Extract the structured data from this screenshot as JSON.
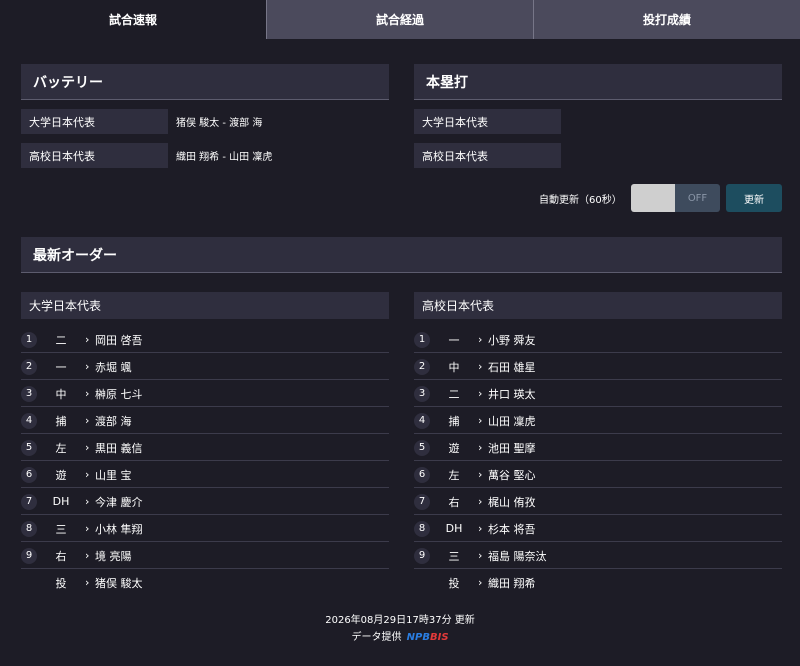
{
  "tabs": [
    "試合速報",
    "試合経過",
    "投打成績"
  ],
  "battery": {
    "title": "バッテリー",
    "rows": [
      {
        "team": "大学日本代表",
        "value": "猪俣 駿太 - 渡部 海"
      },
      {
        "team": "高校日本代表",
        "value": "織田 翔希 - 山田 凜虎"
      }
    ]
  },
  "homerun": {
    "title": "本塁打",
    "rows": [
      {
        "team": "大学日本代表",
        "value": ""
      },
      {
        "team": "高校日本代表",
        "value": ""
      }
    ]
  },
  "auto_refresh": {
    "label": "自動更新（60秒）",
    "state": "OFF",
    "button": "更新"
  },
  "order": {
    "title": "最新オーダー",
    "teams": [
      {
        "name": "大学日本代表",
        "players": [
          {
            "num": "1",
            "pos": "二",
            "name": "岡田 啓吾"
          },
          {
            "num": "2",
            "pos": "一",
            "name": "赤堀 颯"
          },
          {
            "num": "3",
            "pos": "中",
            "name": "榊原 七斗"
          },
          {
            "num": "4",
            "pos": "捕",
            "name": "渡部 海"
          },
          {
            "num": "5",
            "pos": "左",
            "name": "黒田 義信"
          },
          {
            "num": "6",
            "pos": "遊",
            "name": "山里 宝"
          },
          {
            "num": "7",
            "pos": "DH",
            "name": "今津 慶介"
          },
          {
            "num": "8",
            "pos": "三",
            "name": "小林 隼翔"
          },
          {
            "num": "9",
            "pos": "右",
            "name": "境 亮陽"
          },
          {
            "num": "",
            "pos": "投",
            "name": "猪俣 駿太"
          }
        ]
      },
      {
        "name": "高校日本代表",
        "players": [
          {
            "num": "1",
            "pos": "一",
            "name": "小野 舜友"
          },
          {
            "num": "2",
            "pos": "中",
            "name": "石田 雄星"
          },
          {
            "num": "3",
            "pos": "二",
            "name": "井口 瑛太"
          },
          {
            "num": "4",
            "pos": "捕",
            "name": "山田 凜虎"
          },
          {
            "num": "5",
            "pos": "遊",
            "name": "池田 聖摩"
          },
          {
            "num": "6",
            "pos": "左",
            "name": "萬谷 堅心"
          },
          {
            "num": "7",
            "pos": "右",
            "name": "梶山 侑孜"
          },
          {
            "num": "8",
            "pos": "DH",
            "name": "杉本 将吾"
          },
          {
            "num": "9",
            "pos": "三",
            "name": "福島 陽奈汰"
          },
          {
            "num": "",
            "pos": "投",
            "name": "織田 翔希"
          }
        ]
      }
    ]
  },
  "footer": {
    "updated": "2026年08月29日17時37分 更新",
    "provided": "データ提供",
    "logo_a": "NPB",
    "logo_b": "BIS"
  }
}
